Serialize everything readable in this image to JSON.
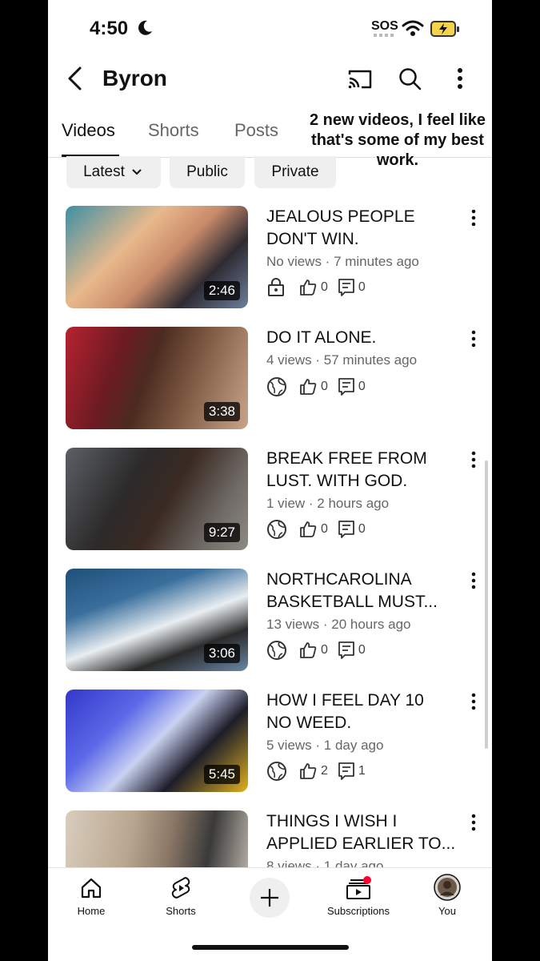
{
  "status_bar": {
    "time": "4:50",
    "sos": "SOS"
  },
  "header": {
    "title": "Byron"
  },
  "tabs": [
    {
      "label": "Videos"
    },
    {
      "label": "Shorts"
    },
    {
      "label": "Posts"
    }
  ],
  "caption": {
    "line1": "2 new videos, I feel like",
    "line2": "that's some of my best",
    "line3": "work."
  },
  "chips": {
    "latest": "Latest",
    "public": "Public",
    "private": "Private"
  },
  "videos": [
    {
      "title1": "JEALOUS PEOPLE",
      "title2": "DON'T WIN.",
      "meta": "No views · 7 minutes ago",
      "duration": "2:46",
      "visibility": "private-lock-icon",
      "likes": "0",
      "comments": "0"
    },
    {
      "title1": "DO IT ALONE.",
      "title2": "",
      "meta": "4 views · 57 minutes ago",
      "duration": "3:38",
      "visibility": "public-globe-icon",
      "likes": "0",
      "comments": "0"
    },
    {
      "title1": "BREAK FREE FROM",
      "title2": "LUST. WITH GOD.",
      "meta": "1 view · 2 hours ago",
      "duration": "9:27",
      "visibility": "public-globe-icon",
      "likes": "0",
      "comments": "0"
    },
    {
      "title1": "NORTHCAROLINA",
      "title2": "BASKETBALL MUST...",
      "meta": "13 views · 20 hours ago",
      "duration": "3:06",
      "visibility": "public-globe-icon",
      "likes": "0",
      "comments": "0"
    },
    {
      "title1": "HOW I FEEL DAY 10",
      "title2": "NO WEED.",
      "meta": "5 views · 1 day ago",
      "duration": "5:45",
      "visibility": "public-globe-icon",
      "likes": "2",
      "comments": "1"
    },
    {
      "title1": "THINGS I WISH I",
      "title2": "APPLIED EARLIER TO...",
      "meta": "8 views · 1 day ago",
      "duration": "",
      "visibility": "public-globe-icon",
      "likes": "",
      "comments": ""
    }
  ],
  "bottom_nav": [
    {
      "label": "Home"
    },
    {
      "label": "Shorts"
    },
    {
      "label": "Subscriptions"
    },
    {
      "label": "You"
    }
  ],
  "colors": {
    "notification_dot": "#ff0033",
    "battery": "#f5d34a"
  }
}
